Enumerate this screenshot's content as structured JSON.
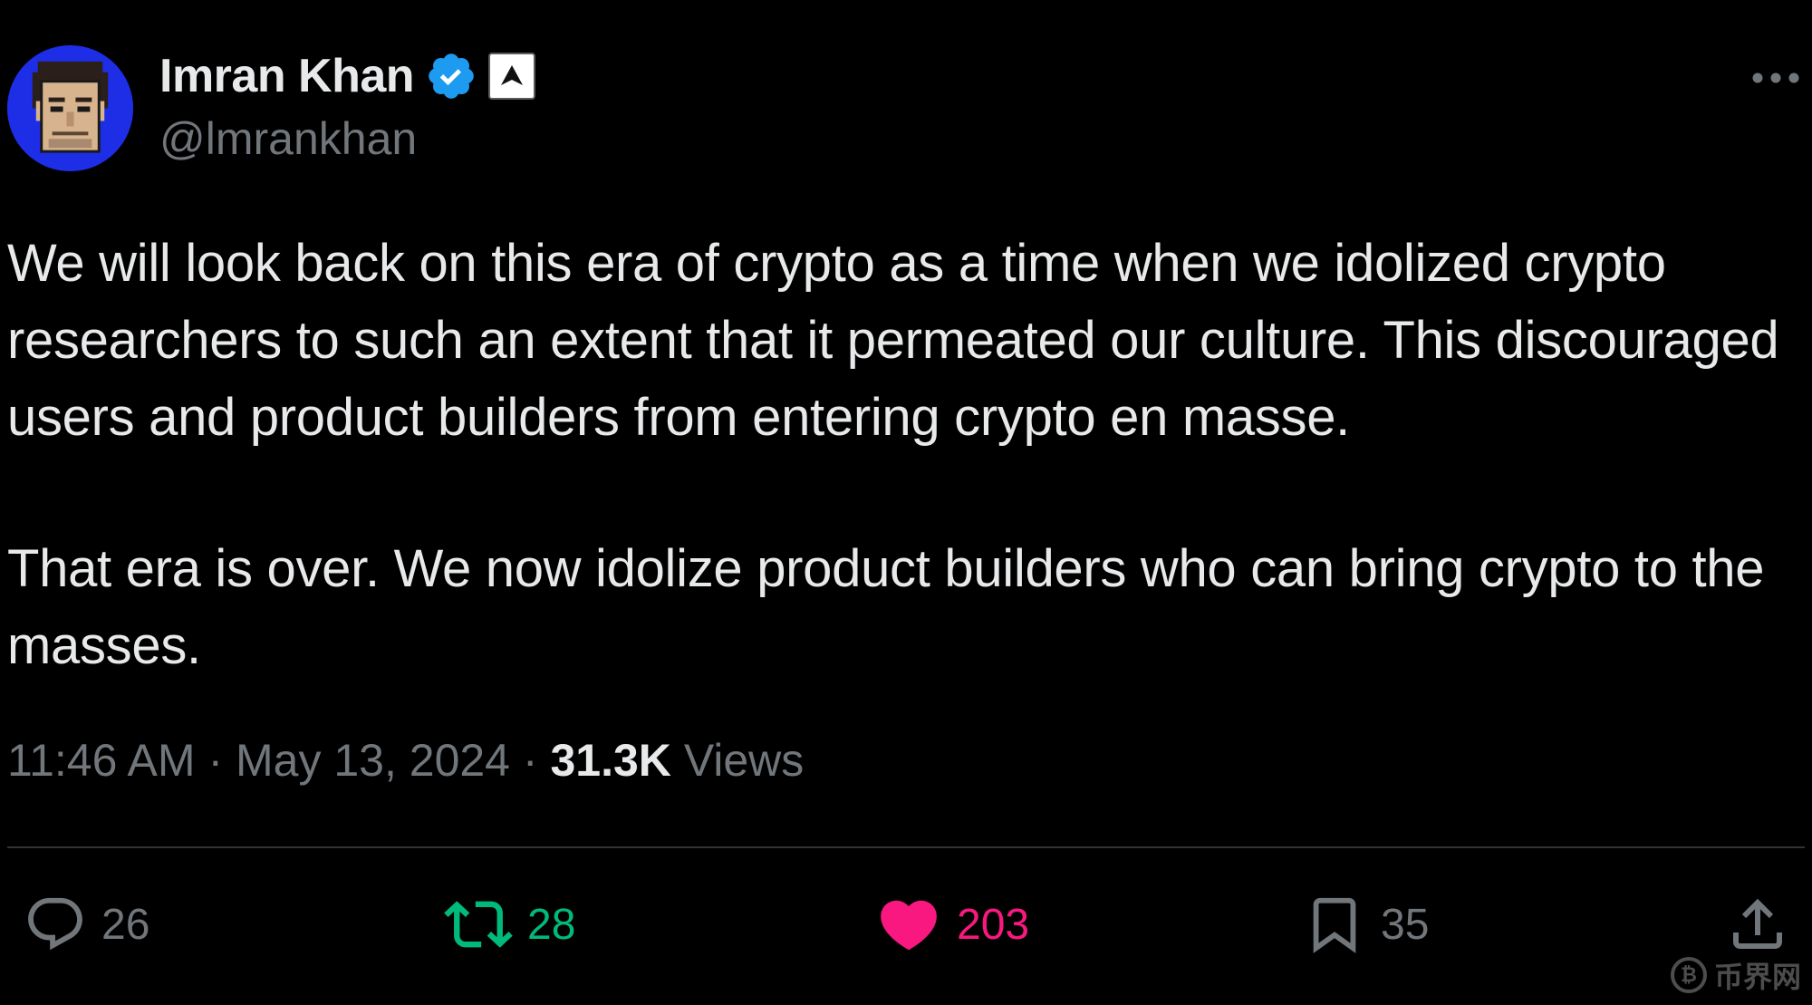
{
  "author": {
    "display_name": "Imran Khan",
    "handle": "@lmrankhan",
    "verified": true,
    "avatar_icon": "pixel-art-face-avatar",
    "badge_icon": "affiliate-arrow-badge-icon"
  },
  "tweet": {
    "paragraphs": [
      "We will look back on this era of crypto as a time when we idolized crypto researchers to such an extent that it permeated our culture. This discouraged users and product builders from entering crypto en masse.",
      "That era is over. We now idolize product builders who can bring crypto to the masses."
    ]
  },
  "meta": {
    "time": "11:46 AM",
    "separator": "·",
    "date": "May 13, 2024",
    "views_count": "31.3K",
    "views_label": "Views"
  },
  "actions": {
    "replies": "26",
    "reposts": "28",
    "likes": "203",
    "bookmarks": "35"
  },
  "watermark": {
    "text": "币界网"
  },
  "colors": {
    "background": "#000000",
    "text_primary": "#e7e9ea",
    "text_secondary": "#71767b",
    "verified_blue": "#1d9bf0",
    "repost_green": "#00ba7c",
    "like_pink": "#f91880",
    "divider": "#2f3336"
  }
}
